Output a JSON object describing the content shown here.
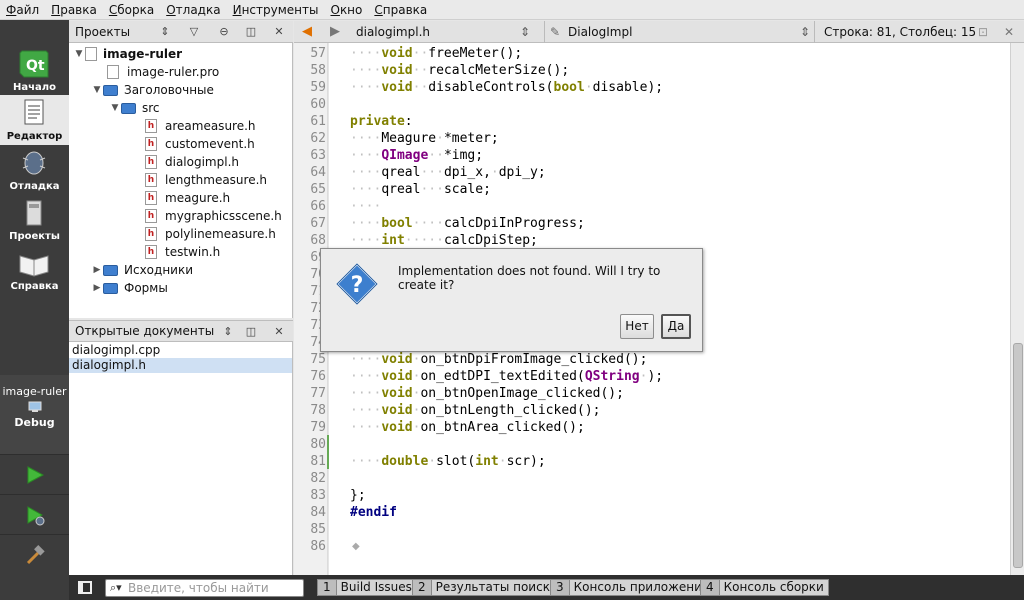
{
  "menu": [
    {
      "underline": "Ф",
      "rest": "айл"
    },
    {
      "underline": "П",
      "rest": "равка"
    },
    {
      "underline": "С",
      "rest": "борка"
    },
    {
      "underline": "О",
      "rest": "тладка"
    },
    {
      "underline": "И",
      "rest": "нструменты"
    },
    {
      "underline": "О",
      "rest": "кно"
    },
    {
      "underline": "С",
      "rest": "правка"
    }
  ],
  "modes": {
    "welcome": "Начало",
    "edit": "Редактор",
    "debug": "Отладка",
    "projects": "Проекты",
    "help": "Справка"
  },
  "target": {
    "project": "image-ruler",
    "config": "Debug"
  },
  "projects_panel": {
    "title": "Проекты",
    "root": "image-ruler",
    "pro_file": "image-ruler.pro",
    "headers_folder": "Заголовочные",
    "src_folder": "src",
    "headers": [
      "areameasure.h",
      "customevent.h",
      "dialogimpl.h",
      "lengthmeasure.h",
      "meagure.h",
      "mygraphicsscene.h",
      "polylinemeasure.h",
      "testwin.h"
    ],
    "sources_folder": "Исходники",
    "forms_folder": "Формы"
  },
  "open_docs": {
    "title": "Открытые документы",
    "items": [
      "dialogimpl.cpp",
      "dialogimpl.h"
    ]
  },
  "editor": {
    "file": "dialogimpl.h",
    "symbol": "DialogImpl",
    "position": "Строка: 81, Столбец: 15",
    "lines": [
      {
        "n": "57",
        "html": "<span class='ws'>····</span><span class='kw'>void</span><span class='ws'>··</span>freeMeter();"
      },
      {
        "n": "58",
        "html": "<span class='ws'>····</span><span class='kw'>void</span><span class='ws'>··</span>recalcMeterSize();"
      },
      {
        "n": "59",
        "html": "<span class='ws'>····</span><span class='kw'>void</span><span class='ws'>··</span>disableControls(<span class='kw'>bool</span><span class='ws'>·</span>disable);"
      },
      {
        "n": "60",
        "html": ""
      },
      {
        "n": "61",
        "html": "<span class='kw'>private</span>:"
      },
      {
        "n": "62",
        "html": "<span class='ws'>····</span>Meagure<span class='ws'>·</span>*meter;"
      },
      {
        "n": "63",
        "html": "<span class='ws'>····</span><span class='ty'>QImage</span><span class='ws'>··</span>*img;"
      },
      {
        "n": "64",
        "html": "<span class='ws'>····</span>qreal<span class='ws'>···</span>dpi_x,<span class='ws'>·</span>dpi_y;"
      },
      {
        "n": "65",
        "html": "<span class='ws'>····</span>qreal<span class='ws'>···</span>scale;"
      },
      {
        "n": "66",
        "html": "<span class='ws'>····</span>"
      },
      {
        "n": "67",
        "html": "<span class='ws'>····</span><span class='kw'>bool</span><span class='ws'>····</span>calcDpiInProgress;"
      },
      {
        "n": "68",
        "html": "<span class='ws'>····</span><span class='kw'>int</span><span class='ws'>·····</span>calcDpiStep;"
      },
      {
        "n": "69",
        "html": ""
      },
      {
        "n": "70",
        "html": ""
      },
      {
        "n": "71",
        "html": ""
      },
      {
        "n": "72",
        "html": ""
      },
      {
        "n": "73",
        "html": ""
      },
      {
        "n": "74",
        "html": ""
      },
      {
        "n": "75",
        "html": "<span class='ws'>····</span><span class='kw'>void</span><span class='ws'>·</span>on_btnDpiFromImage_clicked();"
      },
      {
        "n": "76",
        "html": "<span class='ws'>····</span><span class='kw'>void</span><span class='ws'>·</span>on_edtDPI_textEdited(<span class='ty'>QString</span><span class='ws'>·</span>);"
      },
      {
        "n": "77",
        "html": "<span class='ws'>····</span><span class='kw'>void</span><span class='ws'>·</span>on_btnOpenImage_clicked();"
      },
      {
        "n": "78",
        "html": "<span class='ws'>····</span><span class='kw'>void</span><span class='ws'>·</span>on_btnLength_clicked();"
      },
      {
        "n": "79",
        "html": "<span class='ws'>····</span><span class='kw'>void</span><span class='ws'>·</span>on_btnArea_clicked();"
      },
      {
        "n": "80",
        "html": ""
      },
      {
        "n": "81",
        "html": "<span class='ws'>····</span><span class='kw'>double</span><span class='ws'>·</span>slot(<span class='kw'>int</span><span class='ws'>·</span>scr);"
      },
      {
        "n": "82",
        "html": ""
      },
      {
        "n": "83",
        "html": "};"
      },
      {
        "n": "84",
        "html": "<span class='pp'>#endif</span>"
      },
      {
        "n": "85",
        "html": ""
      },
      {
        "n": "86",
        "html": ""
      }
    ]
  },
  "dialog": {
    "message": "Implementation does not found. Will I try to create it?",
    "no": "Нет",
    "yes": "Да"
  },
  "statusbar": {
    "search_placeholder": "Введите, чтобы найти",
    "tabs": [
      {
        "num": "1",
        "label": "Build Issues"
      },
      {
        "num": "2",
        "label": "Результаты поиска"
      },
      {
        "num": "3",
        "label": "Консоль приложения"
      },
      {
        "num": "4",
        "label": "Консоль сборки"
      }
    ]
  },
  "colors": {
    "keyword": "#808000",
    "type": "#800080",
    "preprocessor": "#000080",
    "modebar": "#3c3c3c"
  }
}
